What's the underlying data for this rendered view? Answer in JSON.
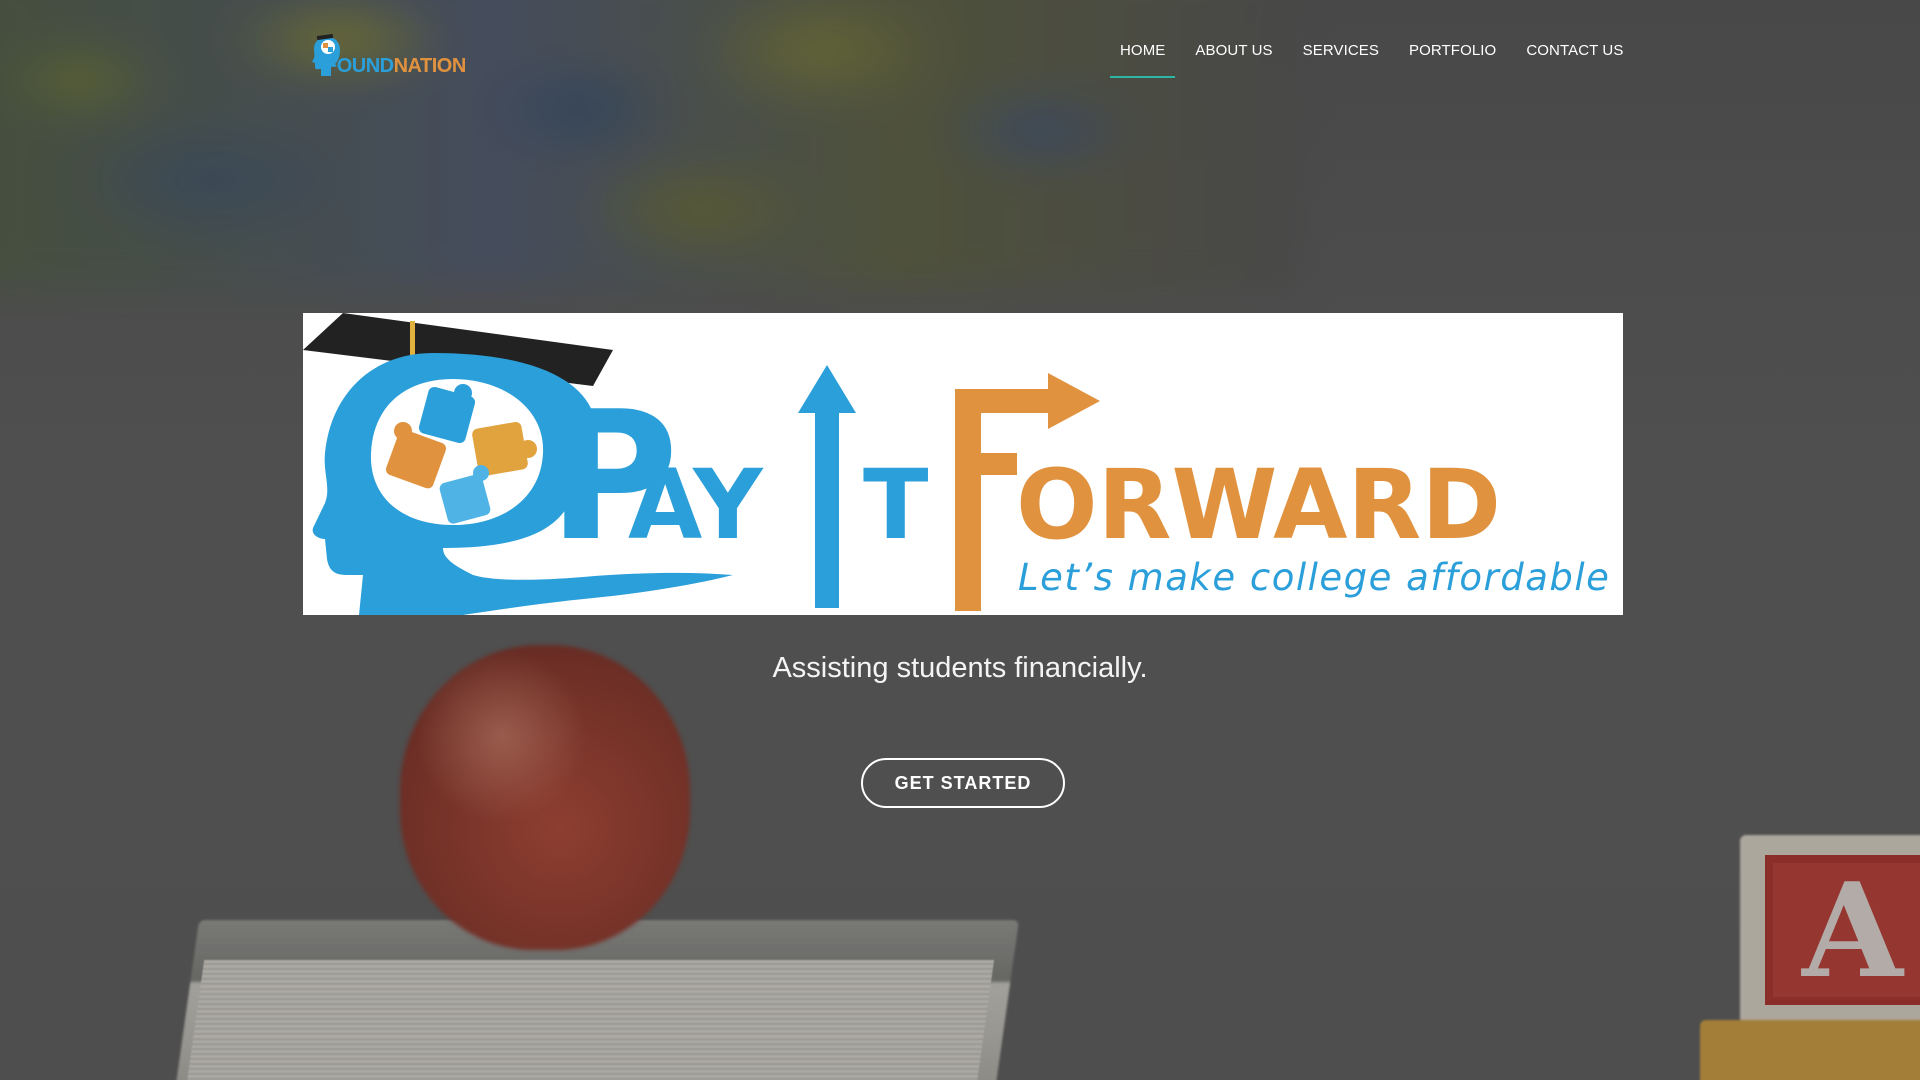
{
  "header": {
    "logo": {
      "text_left": "FOUND",
      "text_right": "NATION"
    },
    "nav": [
      {
        "label": "HOME",
        "active": true
      },
      {
        "label": "ABOUT US",
        "active": false
      },
      {
        "label": "SERVICES",
        "active": false
      },
      {
        "label": "PORTFOLIO",
        "active": false
      },
      {
        "label": "CONTACT US",
        "active": false
      }
    ],
    "active_underline_color": "#2fb5a6"
  },
  "banner": {
    "title_parts": [
      "P",
      "AY",
      "I",
      "T",
      "F",
      "ORWARD"
    ],
    "tagline": "Let’s make college affordable",
    "colors": {
      "blue": "#2b9fd9",
      "orange": "#e1923e",
      "cap": "#222222"
    },
    "icons": [
      "graduation-cap-icon",
      "head-silhouette-icon",
      "puzzle-pieces-icon",
      "up-arrow-icon",
      "right-arrow-icon"
    ]
  },
  "hero": {
    "subtitle": "Assisting students financially.",
    "cta_label": "GET STARTED"
  },
  "background": {
    "scene": [
      "apple",
      "book",
      "toy-block"
    ],
    "block_letter": "A"
  }
}
